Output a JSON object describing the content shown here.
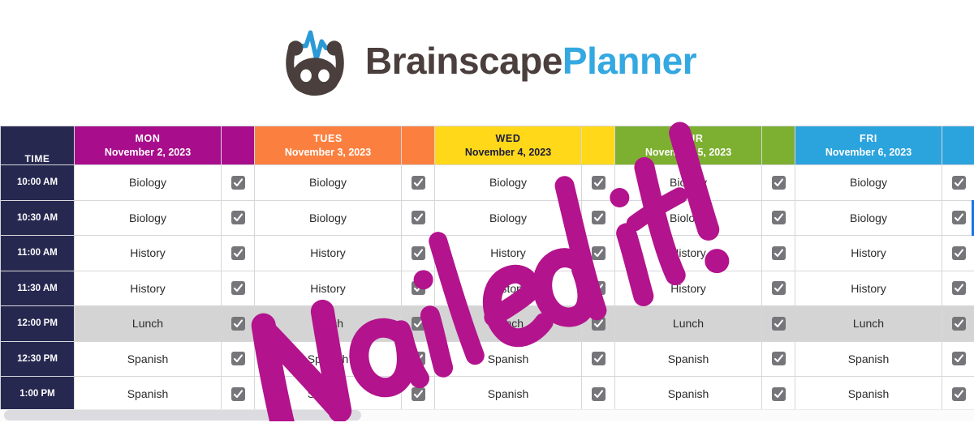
{
  "brand": {
    "logo_icon": "brainscape-robot-icon",
    "name_part_dark": "Brainscape",
    "name_part_blue": "Planner",
    "accent_blue": "#34a8e0",
    "wordmark_dark": "#4a3f3c"
  },
  "annotation": {
    "text": "Nailed it!",
    "color": "#b3138c",
    "style": "handwritten-marker",
    "rotation_deg": -21
  },
  "table": {
    "time_header": "TIME",
    "header_bg_time": "#272850",
    "columns": [
      {
        "dow": "MON",
        "date": "November 2, 2023",
        "bg": "#a80d8b",
        "fg": "#ffffff"
      },
      {
        "dow": "TUES",
        "date": "November 3, 2023",
        "bg": "#fb8040",
        "fg": "#ffffff"
      },
      {
        "dow": "WED",
        "date": "November 4, 2023",
        "bg": "#ffd819",
        "fg": "#1c1c3c"
      },
      {
        "dow": "THUR",
        "date": "November 5, 2023",
        "bg": "#7daf31",
        "fg": "#ffffff"
      },
      {
        "dow": "FRI",
        "date": "November 6, 2023",
        "bg": "#2ba3dd",
        "fg": "#ffffff"
      }
    ],
    "rows": [
      {
        "time": "10:00 AM",
        "highlight": false,
        "cells": [
          "Biology",
          "Biology",
          "Biology",
          "Biology",
          "Biology"
        ],
        "checked": [
          true,
          true,
          true,
          true,
          true
        ]
      },
      {
        "time": "10:30 AM",
        "highlight": false,
        "cells": [
          "Biology",
          "Biology",
          "Biology",
          "Biology",
          "Biology"
        ],
        "checked": [
          true,
          true,
          true,
          true,
          true
        ]
      },
      {
        "time": "11:00 AM",
        "highlight": false,
        "cells": [
          "History",
          "History",
          "History",
          "History",
          "History"
        ],
        "checked": [
          true,
          true,
          true,
          true,
          true
        ]
      },
      {
        "time": "11:30 AM",
        "highlight": false,
        "cells": [
          "History",
          "History",
          "History",
          "History",
          "History"
        ],
        "checked": [
          true,
          true,
          true,
          true,
          true
        ]
      },
      {
        "time": "12:00 PM",
        "highlight": true,
        "cells": [
          "Lunch",
          "Lunch",
          "Lunch",
          "Lunch",
          "Lunch"
        ],
        "checked": [
          true,
          true,
          true,
          true,
          true
        ]
      },
      {
        "time": "12:30 PM",
        "highlight": false,
        "cells": [
          "Spanish",
          "Spanish",
          "Spanish",
          "Spanish",
          "Spanish"
        ],
        "checked": [
          true,
          true,
          true,
          true,
          true
        ]
      },
      {
        "time": "1:00 PM",
        "highlight": false,
        "cells": [
          "Spanish",
          "Spanish",
          "Spanish",
          "Spanish",
          "Spanish"
        ],
        "checked": [
          true,
          true,
          true,
          true,
          true
        ]
      }
    ],
    "selected_row_index": 1,
    "selection_color": "#1a73e8",
    "lunch_row_bg": "#d4d4d4",
    "checkbox_color": "#76767a"
  },
  "scrollbar": {
    "orientation": "horizontal",
    "thumb_fraction": 0.37
  }
}
